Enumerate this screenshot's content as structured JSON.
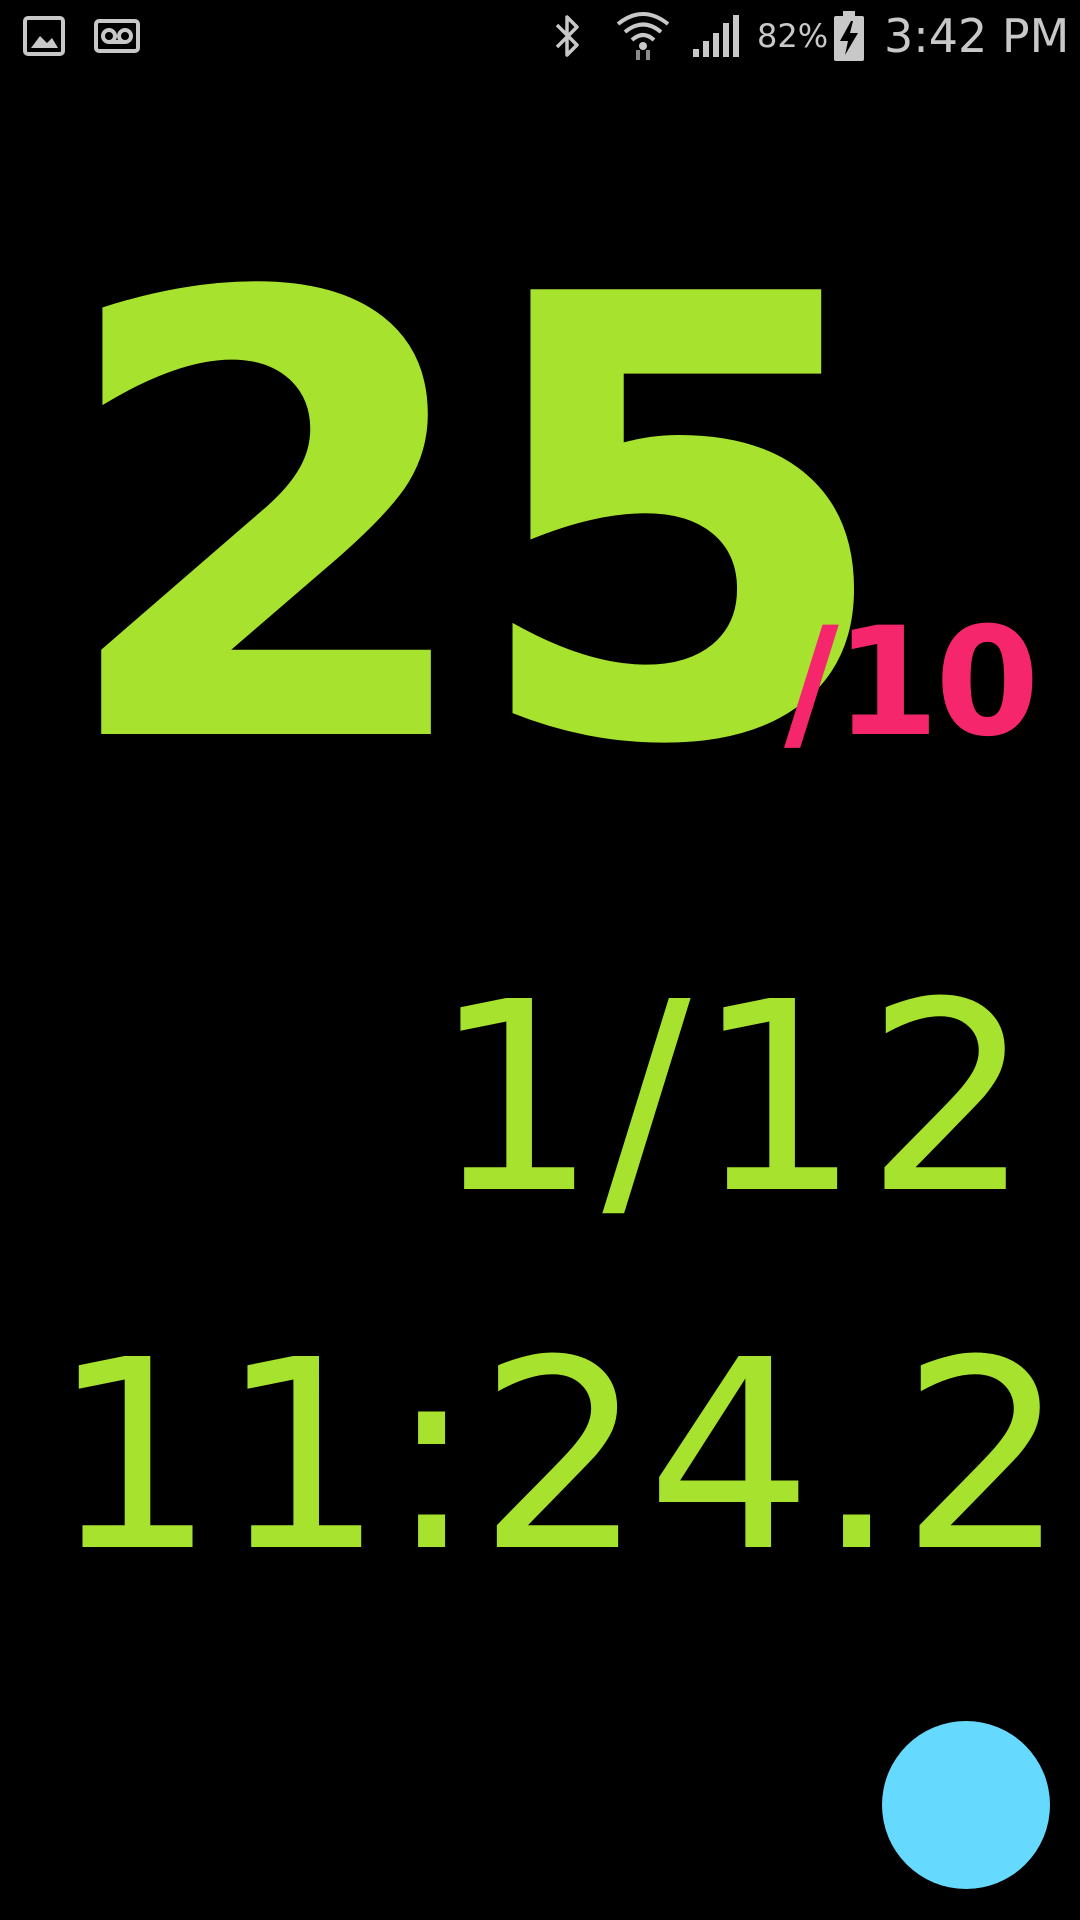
{
  "status_bar": {
    "left_icons": [
      "gallery-icon",
      "voicemail-icon"
    ],
    "right_icons": [
      "bluetooth-icon",
      "wifi-icon",
      "cell-signal-icon",
      "battery-charging-icon"
    ],
    "battery_percent": "82%",
    "clock": "3:42 PM"
  },
  "counter": {
    "current": "25",
    "total": "/10"
  },
  "progress": {
    "fraction": "1/12"
  },
  "timer": {
    "elapsed": "11:24.2"
  },
  "colors": {
    "background": "#000000",
    "primary_text": "#a6e22e",
    "accent_text": "#f5266c",
    "fab": "#66d9ff",
    "status_icons": "#c8c8c8"
  }
}
